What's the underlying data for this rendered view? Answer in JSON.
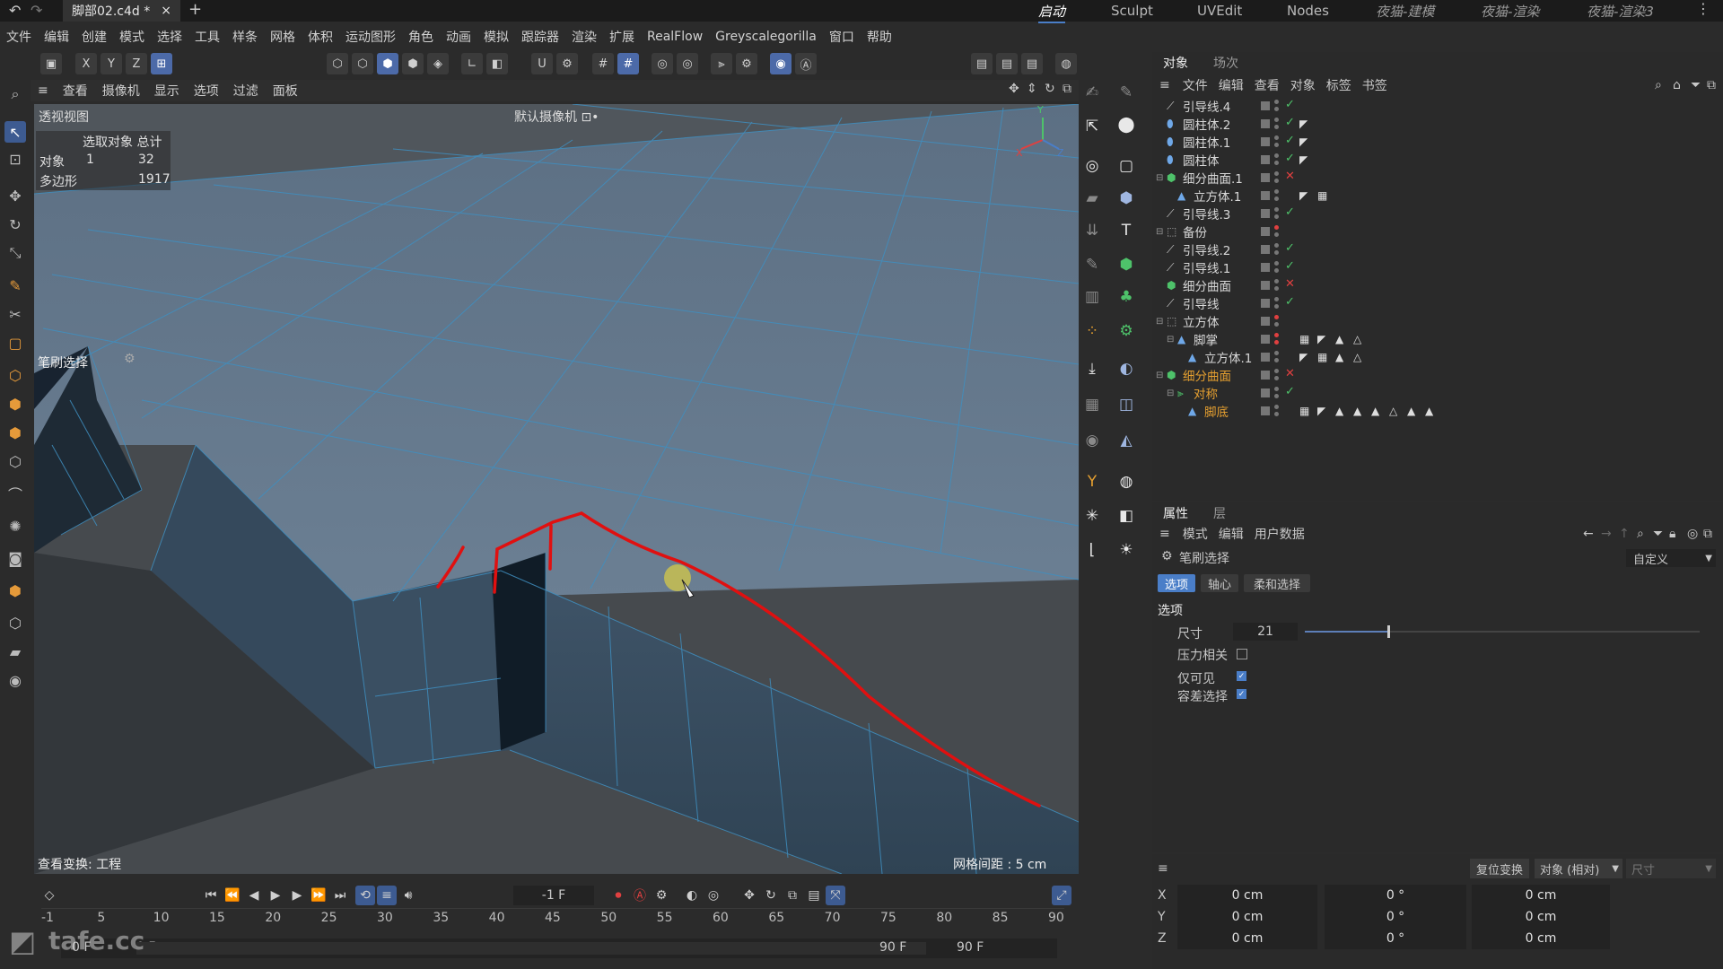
{
  "title_bar": {
    "file_tab": "脚部02.c4d *",
    "close": "×",
    "add": "+",
    "layout_tabs": [
      "启动",
      "Sculpt",
      "UVEdit",
      "Nodes",
      "夜猫-建模",
      "夜猫-渲染",
      "夜猫-渲染3"
    ],
    "more": "⋮"
  },
  "menu": [
    "文件",
    "编辑",
    "创建",
    "模式",
    "选择",
    "工具",
    "样条",
    "网格",
    "体积",
    "运动图形",
    "角色",
    "动画",
    "模拟",
    "跟踪器",
    "渲染",
    "扩展",
    "RealFlow",
    "Greyscalegorilla",
    "窗口",
    "帮助"
  ],
  "toolbar": {
    "axis_x": "X",
    "axis_y": "Y",
    "axis_z": "Z"
  },
  "viewport": {
    "menu": [
      "查看",
      "摄像机",
      "显示",
      "选项",
      "过滤",
      "面板"
    ],
    "view_name": "透视视图",
    "camera": "默认摄像机 ⊡•",
    "stats": {
      "header": "选取对象 总计",
      "rows": [
        {
          "label": "对象",
          "selected": "1",
          "total": "32"
        },
        {
          "label": "多边形",
          "selected": "",
          "total": "1917"
        }
      ]
    },
    "tool_label": "笔刷选择",
    "bottom_left": "查看变换: 工程",
    "bottom_right": "网格间距 : 5 cm",
    "axis_labels": {
      "y": "Y",
      "x": "X",
      "z": "Z"
    }
  },
  "object_manager": {
    "tabs": [
      "对象",
      "场次"
    ],
    "menu": [
      "文件",
      "编辑",
      "查看",
      "对象",
      "标签",
      "书签"
    ],
    "objects": [
      {
        "name": "引导线.4",
        "indent": 0,
        "icon": "spline-icon",
        "status": "check"
      },
      {
        "name": "圆柱体.2",
        "indent": 0,
        "icon": "cylinder-icon",
        "status": "check"
      },
      {
        "name": "圆柱体.1",
        "indent": 0,
        "icon": "cylinder-icon",
        "status": "check"
      },
      {
        "name": "圆柱体",
        "indent": 0,
        "icon": "cylinder-icon",
        "status": "check"
      },
      {
        "name": "细分曲面.1",
        "indent": 0,
        "icon": "subdivision-icon",
        "status": "cross"
      },
      {
        "name": "立方体.1",
        "indent": 1,
        "icon": "polygon-icon",
        "status": ""
      },
      {
        "name": "引导线.3",
        "indent": 0,
        "icon": "spline-icon",
        "status": "check"
      },
      {
        "name": "备份",
        "indent": 0,
        "icon": "null-icon",
        "status": ""
      },
      {
        "name": "引导线.2",
        "indent": 0,
        "icon": "spline-icon",
        "status": "check"
      },
      {
        "name": "引导线.1",
        "indent": 0,
        "icon": "spline-icon",
        "status": "check"
      },
      {
        "name": "细分曲面",
        "indent": 0,
        "icon": "subdivision-icon",
        "status": "cross"
      },
      {
        "name": "引导线",
        "indent": 0,
        "icon": "spline-icon",
        "status": "check"
      },
      {
        "name": "立方体",
        "indent": 0,
        "icon": "null-icon",
        "status": ""
      },
      {
        "name": "脚掌",
        "indent": 1,
        "icon": "polygon-icon",
        "status": ""
      },
      {
        "name": "立方体.1",
        "indent": 2,
        "icon": "polygon-icon",
        "status": ""
      },
      {
        "name": "细分曲面",
        "indent": 0,
        "icon": "subdivision-icon",
        "status": "cross",
        "highlight": "orange"
      },
      {
        "name": "对称",
        "indent": 1,
        "icon": "symmetry-icon",
        "status": "check",
        "highlight": "orange"
      },
      {
        "name": "脚底",
        "indent": 2,
        "icon": "polygon-icon",
        "status": "",
        "highlight": "orange"
      }
    ]
  },
  "attributes": {
    "tabs": [
      "属性",
      "层"
    ],
    "menu": [
      "模式",
      "编辑",
      "用户数据"
    ],
    "tool_name": "笔刷选择",
    "preset": "自定义",
    "subtabs": [
      "选项",
      "轴心",
      "柔和选择"
    ],
    "section": "选项",
    "size_label": "尺寸",
    "size_value": "21",
    "size_fraction": 0.21,
    "pressure_label": "压力相关",
    "visible_only_label": "仅可见",
    "tolerance_label": "容差选择"
  },
  "coords": {
    "reset_button": "复位变换",
    "mode_select": "对象 (相对)",
    "size_label": "尺寸",
    "rows": [
      {
        "axis": "X",
        "pos": "0 cm",
        "rot": "0 °",
        "size": "0 cm"
      },
      {
        "axis": "Y",
        "pos": "0 cm",
        "rot": "0 °",
        "size": "0 cm"
      },
      {
        "axis": "Z",
        "pos": "0 cm",
        "rot": "0 °",
        "size": "0 cm"
      }
    ]
  },
  "timeline": {
    "current_frame": "-1 F",
    "ruler": [
      "-1",
      "5",
      "10",
      "15",
      "20",
      "25",
      "30",
      "35",
      "40",
      "45",
      "50",
      "55",
      "60",
      "65",
      "70",
      "75",
      "80",
      "85",
      "90"
    ],
    "start": "0 F",
    "start2": "0 F",
    "end": "90 F",
    "end2": "90 F"
  },
  "watermark": "tafe.cc",
  "colors": {
    "accent": "#4a7ec8",
    "check": "#4ec26a",
    "cross": "#e04040",
    "highlight": "#e6a030",
    "annotation": "#e01010"
  }
}
